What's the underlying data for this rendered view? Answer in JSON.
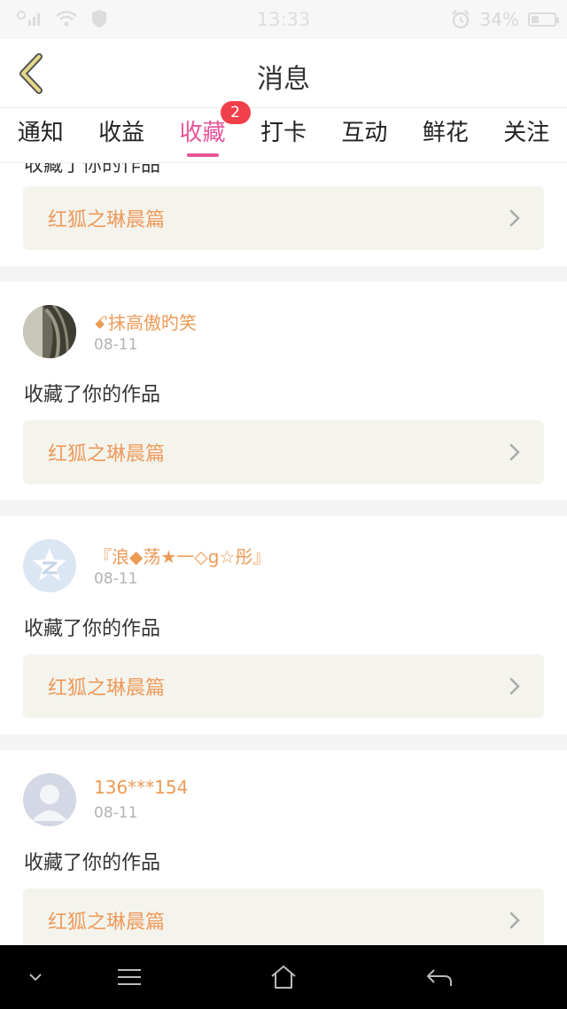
{
  "status_bar": {
    "time": "13:33",
    "battery": "34%",
    "icons": [
      "signal-icon",
      "wifi-icon",
      "shield-icon",
      "alarm-icon",
      "battery-icon"
    ]
  },
  "nav": {
    "title": "消息",
    "back_icon": "chevron-left-icon",
    "back_color": "#e8d98a"
  },
  "tabs": [
    {
      "label": "通知",
      "active": false
    },
    {
      "label": "收益",
      "active": false
    },
    {
      "label": "收藏",
      "active": true,
      "badge": "2"
    },
    {
      "label": "打卡",
      "active": false
    },
    {
      "label": "互动",
      "active": false
    },
    {
      "label": "鲜花",
      "active": false
    },
    {
      "label": "关注",
      "active": false
    }
  ],
  "feed": {
    "partial_card": {
      "action": "收藏了你的作品",
      "work_title": "红狐之琳晨篇"
    },
    "cards": [
      {
        "username": "ꗃ抹高傲旳笑",
        "date": "08-11",
        "action": "收藏了你的作品",
        "work_title": "红狐之琳晨篇",
        "avatar": "photo-avatar"
      },
      {
        "username": "『浪◆荡★一◇g☆彤』",
        "date": "08-11",
        "action": "收藏了你的作品",
        "work_title": "红狐之琳晨篇",
        "avatar": "qzone-logo-avatar"
      },
      {
        "username": "136***154",
        "date": "08-11",
        "action": "收藏了你的作品",
        "work_title": "红狐之琳晨篇",
        "avatar": "default-user-avatar"
      }
    ]
  },
  "colors": {
    "accent": "#e5549a",
    "badge": "#f2404b",
    "username": "#ed9a55",
    "work_link_bg": "#f4f4ed"
  },
  "system_nav": {
    "icons": [
      "collapse-icon",
      "menu-icon",
      "home-icon",
      "back-icon"
    ]
  }
}
